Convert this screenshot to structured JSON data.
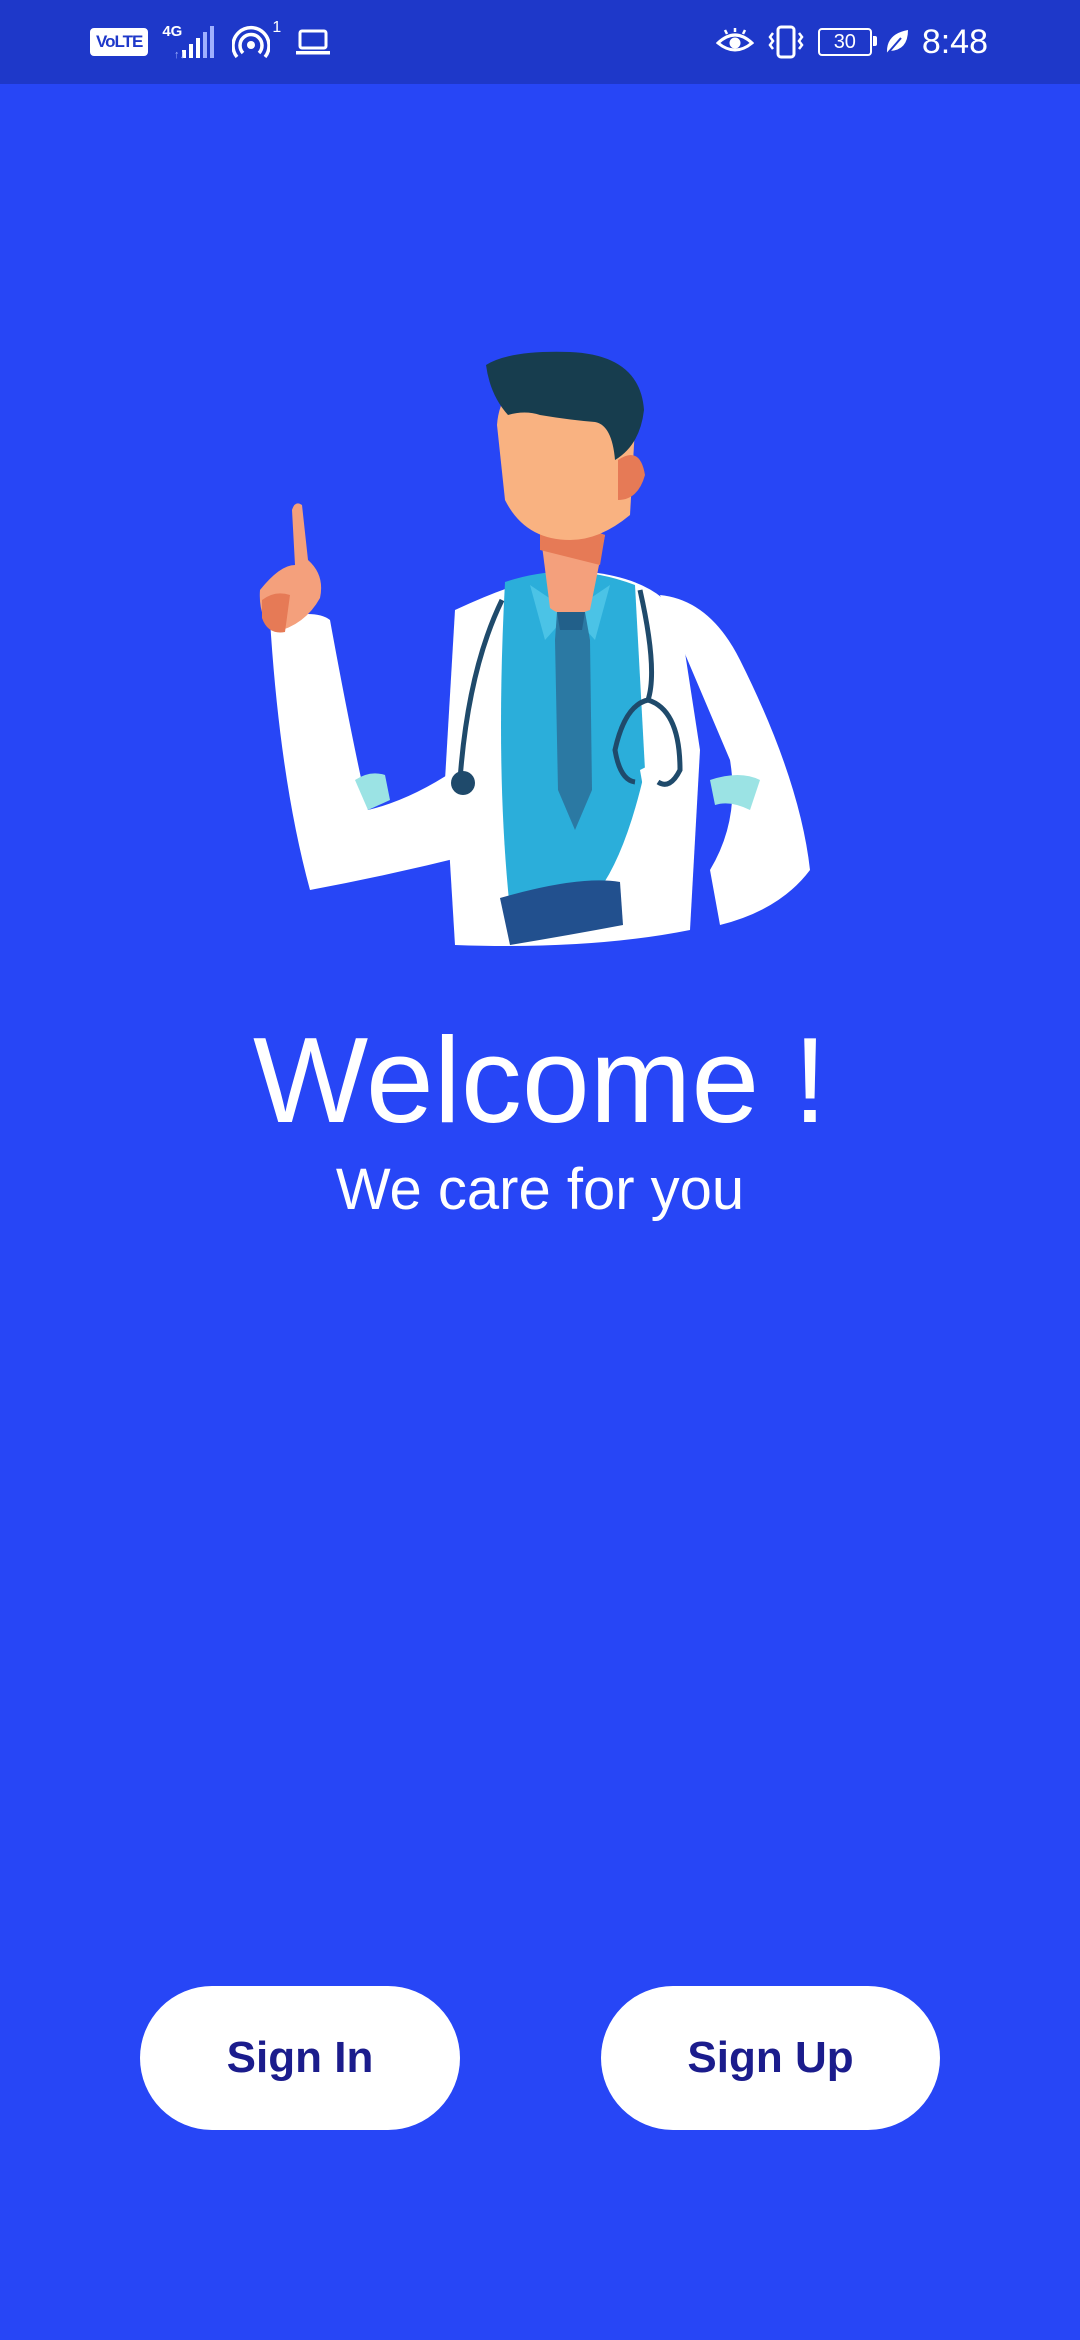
{
  "status_bar": {
    "volte_label": "VoLTE",
    "network_label": "4G",
    "hotspot_count": "1",
    "battery_level": "30",
    "time": "8:48"
  },
  "welcome": {
    "title": "Welcome !",
    "subtitle": "We care for you"
  },
  "actions": {
    "sign_in_label": "Sign In",
    "sign_up_label": "Sign Up"
  },
  "colors": {
    "background": "#2746F6",
    "status_bar": "#1E38C9",
    "button_bg": "#FFFFFF",
    "button_text": "#1B1C8C"
  },
  "icons": {
    "signal": "signal-strength-icon",
    "hotspot": "hotspot-icon",
    "laptop": "laptop-icon",
    "eye": "eye-comfort-icon",
    "vibrate": "vibrate-icon",
    "battery": "battery-icon",
    "leaf": "power-saving-leaf-icon"
  }
}
